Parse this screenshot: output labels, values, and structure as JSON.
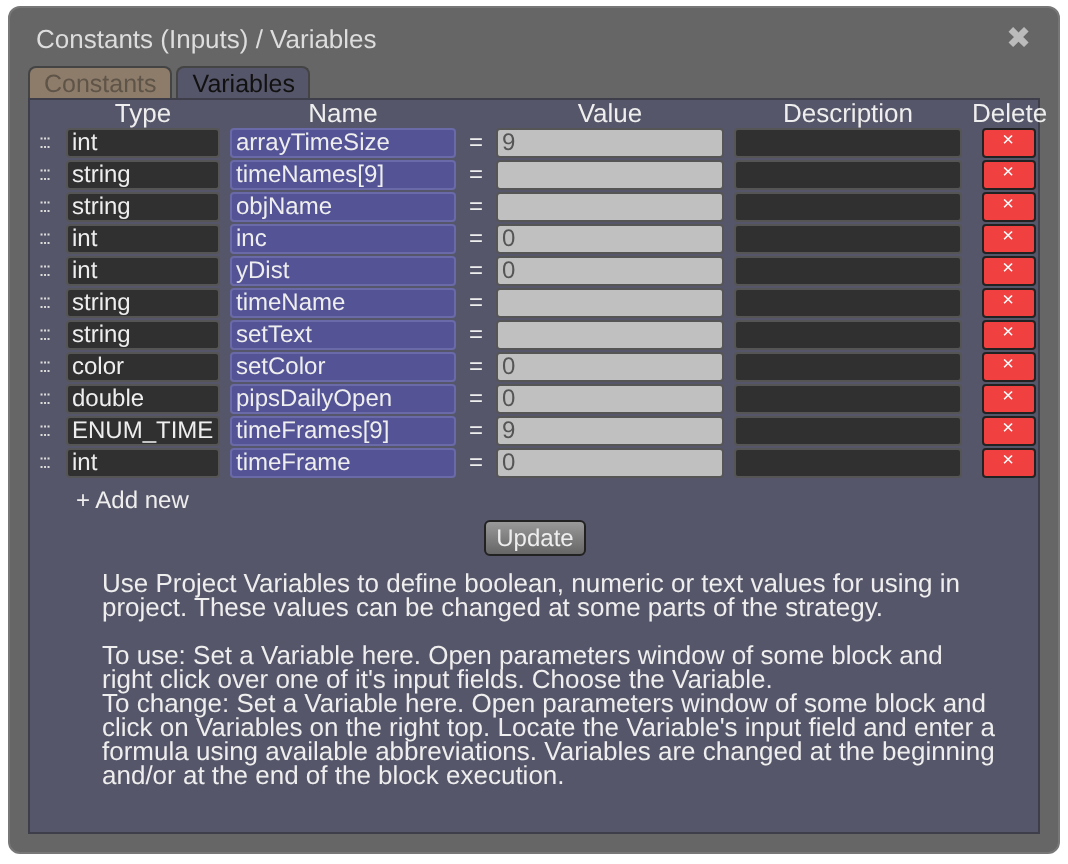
{
  "window": {
    "title": "Constants (Inputs) / Variables",
    "close": "✖"
  },
  "tabs": [
    {
      "label": "Constants",
      "selected": false
    },
    {
      "label": "Variables",
      "selected": true
    }
  ],
  "table": {
    "columns": [
      "Type",
      "Name",
      "Value",
      "Description",
      "Delete"
    ],
    "rows": [
      {
        "handle": ":::",
        "type": "int",
        "name": "arrayTimeSize",
        "equals": "=",
        "value": "9",
        "delete": "×"
      },
      {
        "handle": ":::",
        "type": "string",
        "name": "timeNames[9]",
        "equals": "=",
        "value": "",
        "delete": "×"
      },
      {
        "handle": ":::",
        "type": "string",
        "name": "objName",
        "equals": "=",
        "value": "",
        "delete": "×"
      },
      {
        "handle": ":::",
        "type": "int",
        "name": "inc",
        "equals": "=",
        "value": "0",
        "delete": "×"
      },
      {
        "handle": ":::",
        "type": "int",
        "name": "yDist",
        "equals": "=",
        "value": "0",
        "delete": "×"
      },
      {
        "handle": ":::",
        "type": "string",
        "name": "timeName",
        "equals": "=",
        "value": "",
        "delete": "×"
      },
      {
        "handle": ":::",
        "type": "string",
        "name": "setText",
        "equals": "=",
        "value": "",
        "delete": "×"
      },
      {
        "handle": ":::",
        "type": "color",
        "name": "setColor",
        "equals": "=",
        "value": "0",
        "delete": "×"
      },
      {
        "handle": ":::",
        "type": "double",
        "name": "pipsDailyOpen",
        "equals": "=",
        "value": "0",
        "delete": "×"
      },
      {
        "handle": ":::",
        "type": "ENUM_TIME",
        "name": "timeFrames[9]",
        "equals": "=",
        "value": "9",
        "delete": "×"
      },
      {
        "handle": ":::",
        "type": "int",
        "name": "timeFrame",
        "equals": "=",
        "value": "0",
        "delete": "×"
      }
    ]
  },
  "add_new": "+ Add new",
  "update_button": "Update",
  "help": [
    {
      "paragraphs": [
        "Use Project Variables to define boolean, numeric or text values for using in project. These values can be changed at some parts of the strategy."
      ]
    },
    {
      "paragraphs": [
        "To use: Set a Variable here. Open parameters window of some block and right click over one of it's input fields. Choose the Variable.",
        "To change: Set a Variable here. Open parameters window of some block and click on Variables on the right top. Locate the Variable's input field and enter a formula using available abbreviations. Variables are changed at the beginning and/or at the end of the block execution."
      ]
    }
  ]
}
